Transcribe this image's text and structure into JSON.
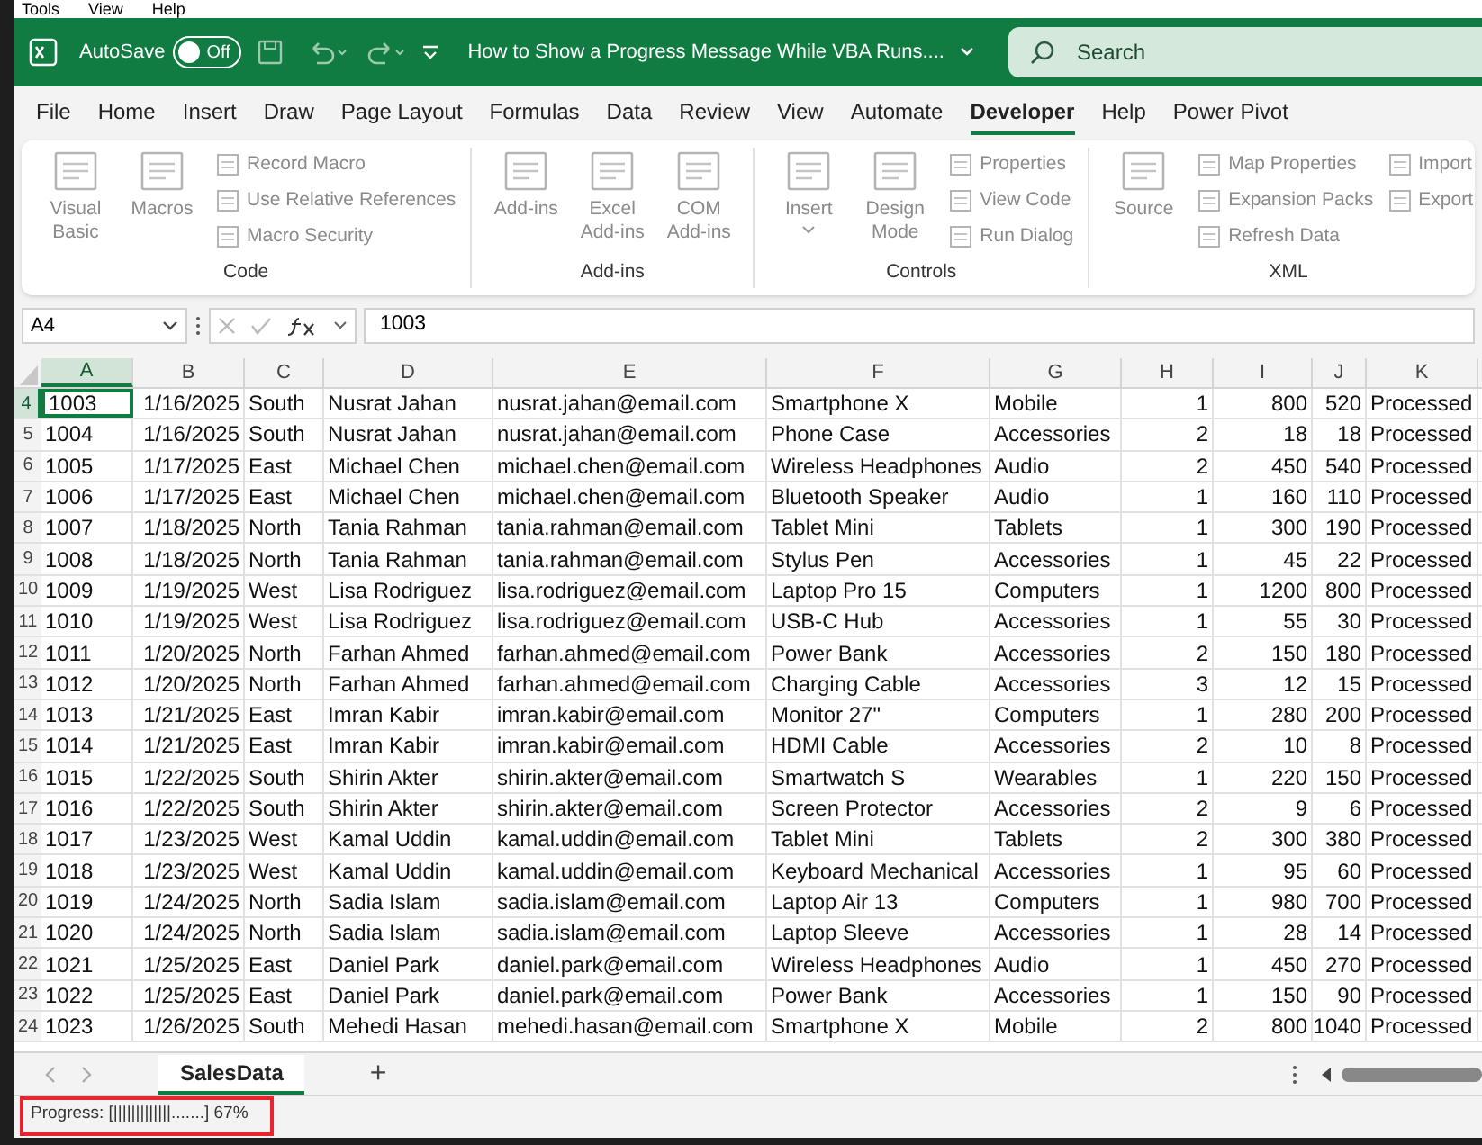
{
  "top_menu": [
    "Tools",
    "View",
    "Help"
  ],
  "title_bar": {
    "autosave_label": "AutoSave",
    "autosave_state": "Off",
    "autosave_on": false,
    "title": "How to Show a Progress Message While VBA Runs....",
    "search_placeholder": "Search"
  },
  "ribbon_tabs": [
    {
      "label": "File",
      "selected": false
    },
    {
      "label": "Home",
      "selected": false
    },
    {
      "label": "Insert",
      "selected": false
    },
    {
      "label": "Draw",
      "selected": false
    },
    {
      "label": "Page Layout",
      "selected": false
    },
    {
      "label": "Formulas",
      "selected": false
    },
    {
      "label": "Data",
      "selected": false
    },
    {
      "label": "Review",
      "selected": false
    },
    {
      "label": "View",
      "selected": false
    },
    {
      "label": "Automate",
      "selected": false
    },
    {
      "label": "Developer",
      "selected": true
    },
    {
      "label": "Help",
      "selected": false
    },
    {
      "label": "Power Pivot",
      "selected": false
    }
  ],
  "ribbon_groups": [
    {
      "label": "Code",
      "large": [
        {
          "label": "Visual Basic",
          "disabled": true
        },
        {
          "label": "Macros",
          "disabled": true
        }
      ],
      "stacks": [
        [
          {
            "label": "Record Macro",
            "disabled": true
          },
          {
            "label": "Use Relative References",
            "disabled": true
          },
          {
            "label": "Macro Security",
            "disabled": true
          }
        ]
      ]
    },
    {
      "label": "Add-ins",
      "large": [
        {
          "label": "Add-ins",
          "disabled": true
        },
        {
          "label": "Excel Add-ins",
          "disabled": true
        },
        {
          "label": "COM Add-ins",
          "disabled": true
        }
      ]
    },
    {
      "label": "Controls",
      "large": [
        {
          "label": "Insert",
          "disabled": true,
          "caret": true
        },
        {
          "label": "Design Mode",
          "disabled": true
        }
      ],
      "stacks": [
        [
          {
            "label": "Properties",
            "disabled": true
          },
          {
            "label": "View Code",
            "disabled": true
          },
          {
            "label": "Run Dialog",
            "disabled": true
          }
        ]
      ]
    },
    {
      "label": "XML",
      "large": [
        {
          "label": "Source",
          "disabled": true
        }
      ],
      "stacks": [
        [
          {
            "label": "Map Properties",
            "disabled": true
          },
          {
            "label": "Expansion Packs",
            "disabled": true
          },
          {
            "label": "Refresh Data",
            "disabled": true
          }
        ],
        [
          {
            "label": "Import",
            "disabled": true
          },
          {
            "label": "Export",
            "disabled": true
          }
        ]
      ]
    }
  ],
  "formula_bar": {
    "name_box": "A4",
    "value": "1003"
  },
  "sheet": {
    "columns": [
      {
        "label": "A",
        "kind": "text",
        "selected": true
      },
      {
        "label": "B",
        "kind": "number",
        "selected": false
      },
      {
        "label": "C",
        "kind": "text",
        "selected": false
      },
      {
        "label": "D",
        "kind": "text",
        "selected": false
      },
      {
        "label": "E",
        "kind": "text",
        "selected": false
      },
      {
        "label": "F",
        "kind": "text",
        "selected": false
      },
      {
        "label": "G",
        "kind": "text",
        "selected": false
      },
      {
        "label": "H",
        "kind": "number",
        "selected": false
      },
      {
        "label": "I",
        "kind": "number",
        "selected": false
      },
      {
        "label": "J",
        "kind": "number",
        "selected": false
      },
      {
        "label": "K",
        "kind": "text",
        "selected": false
      }
    ],
    "rows": [
      {
        "number": "4",
        "selected": true,
        "cells": [
          "1003",
          "1/16/2025",
          "South",
          "Nusrat Jahan",
          "nusrat.jahan@email.com",
          "Smartphone X",
          "Mobile",
          "1",
          "800",
          "520",
          "Processed"
        ]
      },
      {
        "number": "5",
        "selected": false,
        "cells": [
          "1004",
          "1/16/2025",
          "South",
          "Nusrat Jahan",
          "nusrat.jahan@email.com",
          "Phone Case",
          "Accessories",
          "2",
          "18",
          "18",
          "Processed"
        ]
      },
      {
        "number": "6",
        "selected": false,
        "cells": [
          "1005",
          "1/17/2025",
          "East",
          "Michael Chen",
          "michael.chen@email.com",
          "Wireless Headphones",
          "Audio",
          "2",
          "450",
          "540",
          "Processed"
        ]
      },
      {
        "number": "7",
        "selected": false,
        "cells": [
          "1006",
          "1/17/2025",
          "East",
          "Michael Chen",
          "michael.chen@email.com",
          "Bluetooth Speaker",
          "Audio",
          "1",
          "160",
          "110",
          "Processed"
        ]
      },
      {
        "number": "8",
        "selected": false,
        "cells": [
          "1007",
          "1/18/2025",
          "North",
          "Tania Rahman",
          "tania.rahman@email.com",
          "Tablet Mini",
          "Tablets",
          "1",
          "300",
          "190",
          "Processed"
        ]
      },
      {
        "number": "9",
        "selected": false,
        "cells": [
          "1008",
          "1/18/2025",
          "North",
          "Tania Rahman",
          "tania.rahman@email.com",
          "Stylus Pen",
          "Accessories",
          "1",
          "45",
          "22",
          "Processed"
        ]
      },
      {
        "number": "10",
        "selected": false,
        "cells": [
          "1009",
          "1/19/2025",
          "West",
          "Lisa Rodriguez",
          "lisa.rodriguez@email.com",
          "Laptop Pro 15",
          "Computers",
          "1",
          "1200",
          "800",
          "Processed"
        ]
      },
      {
        "number": "11",
        "selected": false,
        "cells": [
          "1010",
          "1/19/2025",
          "West",
          "Lisa Rodriguez",
          "lisa.rodriguez@email.com",
          "USB-C Hub",
          "Accessories",
          "1",
          "55",
          "30",
          "Processed"
        ]
      },
      {
        "number": "12",
        "selected": false,
        "cells": [
          "1011",
          "1/20/2025",
          "North",
          "Farhan Ahmed",
          "farhan.ahmed@email.com",
          "Power Bank",
          "Accessories",
          "2",
          "150",
          "180",
          "Processed"
        ]
      },
      {
        "number": "13",
        "selected": false,
        "cells": [
          "1012",
          "1/20/2025",
          "North",
          "Farhan Ahmed",
          "farhan.ahmed@email.com",
          "Charging Cable",
          "Accessories",
          "3",
          "12",
          "15",
          "Processed"
        ]
      },
      {
        "number": "14",
        "selected": false,
        "cells": [
          "1013",
          "1/21/2025",
          "East",
          "Imran Kabir",
          "imran.kabir@email.com",
          "Monitor 27\"",
          "Computers",
          "1",
          "280",
          "200",
          "Processed"
        ]
      },
      {
        "number": "15",
        "selected": false,
        "cells": [
          "1014",
          "1/21/2025",
          "East",
          "Imran Kabir",
          "imran.kabir@email.com",
          "HDMI Cable",
          "Accessories",
          "2",
          "10",
          "8",
          "Processed"
        ]
      },
      {
        "number": "16",
        "selected": false,
        "cells": [
          "1015",
          "1/22/2025",
          "South",
          "Shirin Akter",
          "shirin.akter@email.com",
          "Smartwatch S",
          "Wearables",
          "1",
          "220",
          "150",
          "Processed"
        ]
      },
      {
        "number": "17",
        "selected": false,
        "cells": [
          "1016",
          "1/22/2025",
          "South",
          "Shirin Akter",
          "shirin.akter@email.com",
          "Screen Protector",
          "Accessories",
          "2",
          "9",
          "6",
          "Processed"
        ]
      },
      {
        "number": "18",
        "selected": false,
        "cells": [
          "1017",
          "1/23/2025",
          "West",
          "Kamal Uddin",
          "kamal.uddin@email.com",
          "Tablet Mini",
          "Tablets",
          "2",
          "300",
          "380",
          "Processed"
        ]
      },
      {
        "number": "19",
        "selected": false,
        "cells": [
          "1018",
          "1/23/2025",
          "West",
          "Kamal Uddin",
          "kamal.uddin@email.com",
          "Keyboard Mechanical",
          "Accessories",
          "1",
          "95",
          "60",
          "Processed"
        ]
      },
      {
        "number": "20",
        "selected": false,
        "cells": [
          "1019",
          "1/24/2025",
          "North",
          "Sadia Islam",
          "sadia.islam@email.com",
          "Laptop Air 13",
          "Computers",
          "1",
          "980",
          "700",
          "Processed"
        ]
      },
      {
        "number": "21",
        "selected": false,
        "cells": [
          "1020",
          "1/24/2025",
          "North",
          "Sadia Islam",
          "sadia.islam@email.com",
          "Laptop Sleeve",
          "Accessories",
          "1",
          "28",
          "14",
          "Processed"
        ]
      },
      {
        "number": "22",
        "selected": false,
        "cells": [
          "1021",
          "1/25/2025",
          "East",
          "Daniel Park",
          "daniel.park@email.com",
          "Wireless Headphones",
          "Audio",
          "1",
          "450",
          "270",
          "Processed"
        ]
      },
      {
        "number": "23",
        "selected": false,
        "cells": [
          "1022",
          "1/25/2025",
          "East",
          "Daniel Park",
          "daniel.park@email.com",
          "Power Bank",
          "Accessories",
          "1",
          "150",
          "90",
          "Processed"
        ]
      },
      {
        "number": "24",
        "selected": false,
        "cells": [
          "1023",
          "1/26/2025",
          "South",
          "Mehedi Hasan",
          "mehedi.hasan@email.com",
          "Smartphone X",
          "Mobile",
          "2",
          "800",
          "1040",
          "Processed"
        ]
      }
    ]
  },
  "sheet_tabs": [
    {
      "label": "SalesData",
      "selected": true
    }
  ],
  "add_sheet": "+",
  "status_bar": {
    "text": "Progress: [|||||||||||||.......] 67%",
    "highlighted": true
  }
}
